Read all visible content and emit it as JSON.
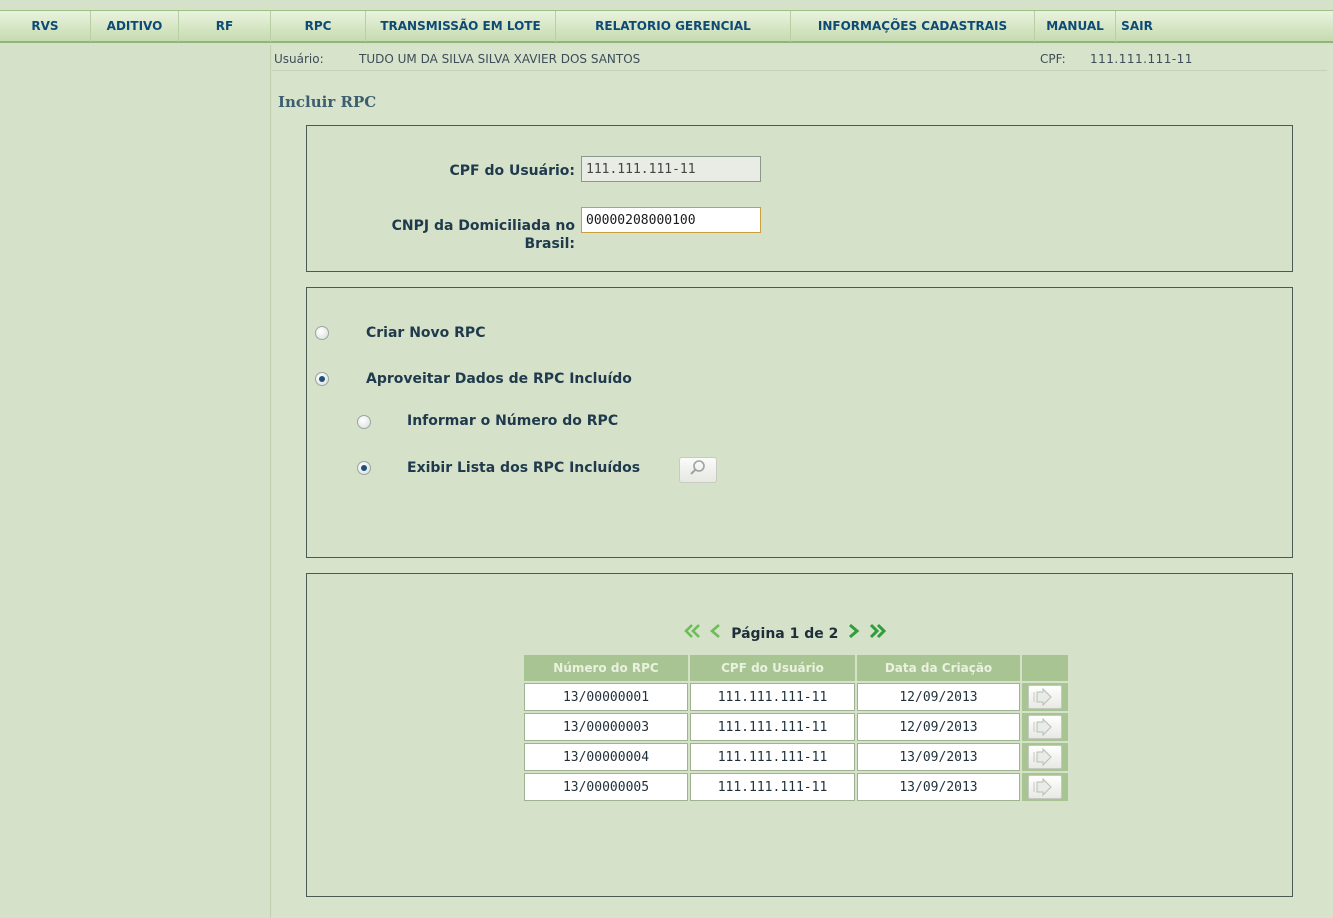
{
  "menu": {
    "items": [
      "RVS",
      "ADITIVO",
      "RF",
      "RPC",
      "TRANSMISSÃO EM LOTE",
      "RELATORIO GERENCIAL",
      "INFORMAÇÕES CADASTRAIS",
      "MANUAL",
      "SAIR"
    ]
  },
  "user_bar": {
    "user_label": "Usuário:",
    "user_name": "TUDO UM DA SILVA SILVA XAVIER DOS SANTOS",
    "cpf_label": "CPF:",
    "cpf_value": "111.111.111-11"
  },
  "page": {
    "title": "Incluir RPC"
  },
  "form": {
    "cpf_label": "CPF do Usuário:",
    "cpf_value": "111.111.111-11",
    "cnpj_label_line1": "CNPJ da Domiciliada no",
    "cnpj_label_line2": "Brasil:",
    "cnpj_value": "00000208000100"
  },
  "options": {
    "criar_novo": {
      "label": "Criar Novo RPC",
      "checked": false
    },
    "aproveitar": {
      "label": "Aproveitar Dados de RPC Incluído",
      "checked": true
    },
    "informar_numero": {
      "label": "Informar o Número do RPC",
      "checked": false
    },
    "exibir_lista": {
      "label": "Exibir Lista dos RPC Incluídos",
      "checked": true
    }
  },
  "pager": {
    "text": "Página 1 de 2",
    "first": "«",
    "prev": "‹",
    "next": "›",
    "last": "»"
  },
  "table": {
    "headers": [
      "Número do RPC",
      "CPF do Usuário",
      "Data da Criação"
    ],
    "rows": [
      [
        "13/00000001",
        "111.111.111-11",
        "12/09/2013"
      ],
      [
        "13/00000003",
        "111.111.111-11",
        "12/09/2013"
      ],
      [
        "13/00000004",
        "111.111.111-11",
        "13/09/2013"
      ],
      [
        "13/00000005",
        "111.111.111-11",
        "13/09/2013"
      ]
    ]
  },
  "icons": {
    "search": "magnifier-icon",
    "row_action": "arrow-right-icon"
  },
  "colors": {
    "accent": "#0e4a76",
    "header_bg": "#a9c493",
    "pager": "#5db04a"
  }
}
